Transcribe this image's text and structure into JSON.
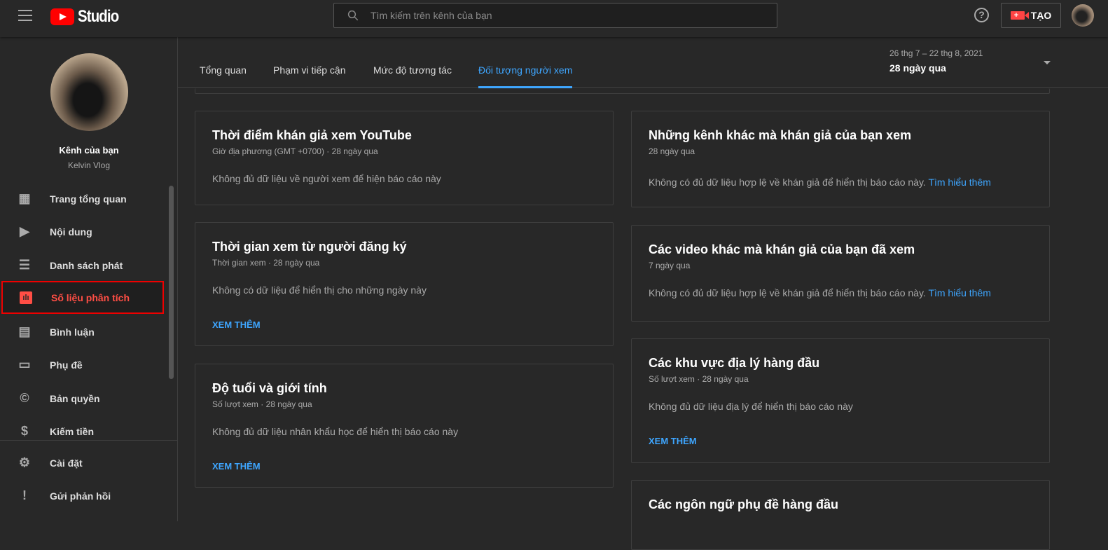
{
  "header": {
    "logo": "Studio",
    "search_placeholder": "Tìm kiếm trên kênh của bạn",
    "help": "?",
    "create": "TẠO"
  },
  "channel": {
    "title": "Kênh của bạn",
    "name": "Kelvin Vlog"
  },
  "sidebar": {
    "items": [
      {
        "label": "Trang tổng quan",
        "icon": "dashboard-icon"
      },
      {
        "label": "Nội dung",
        "icon": "content-icon"
      },
      {
        "label": "Danh sách phát",
        "icon": "playlist-icon"
      },
      {
        "label": "Số liệu phân tích",
        "icon": "analytics-icon",
        "active": true
      },
      {
        "label": "Bình luận",
        "icon": "comments-icon"
      },
      {
        "label": "Phụ đề",
        "icon": "subtitles-icon"
      },
      {
        "label": "Bản quyền",
        "icon": "copyright-icon"
      },
      {
        "label": "Kiếm tiền",
        "icon": "monetization-icon"
      },
      {
        "label": "Cài đặt",
        "icon": "settings-icon"
      },
      {
        "label": "Gửi phản hồi",
        "icon": "feedback-icon"
      }
    ]
  },
  "tabs": [
    "Tổng quan",
    "Phạm vi tiếp cận",
    "Mức độ tương tác",
    "Đối tượng người xem"
  ],
  "range": {
    "dates": "26 thg 7 – 22 thg 8, 2021",
    "period": "28 ngày qua"
  },
  "cards": {
    "c1": {
      "title": "Thời điểm khán giả xem YouTube",
      "sub": "Giờ địa phương (GMT +0700) · 28 ngày qua",
      "msg": "Không đủ dữ liệu về người xem để hiện báo cáo này"
    },
    "c2": {
      "title": "Thời gian xem từ người đăng ký",
      "sub": "Thời gian xem · 28 ngày qua",
      "msg": "Không có dữ liệu để hiển thị cho những ngày này",
      "more": "XEM THÊM"
    },
    "c3": {
      "title": "Độ tuổi và giới tính",
      "sub": "Số lượt xem · 28 ngày qua",
      "msg": "Không đủ dữ liệu nhân khẩu học để hiển thị báo cáo này",
      "more": "XEM THÊM"
    },
    "c4": {
      "title": "Những kênh khác mà khán giả của bạn xem",
      "sub": "28 ngày qua",
      "msg": "Không có đủ dữ liệu hợp lệ về khán giả để hiển thị báo cáo này.",
      "link": "Tìm hiểu thêm"
    },
    "c5": {
      "title": "Các video khác mà khán giả của bạn đã xem",
      "sub": "7 ngày qua",
      "msg": "Không có đủ dữ liệu hợp lệ về khán giả để hiển thị báo cáo này.",
      "link": "Tìm hiểu thêm"
    },
    "c6": {
      "title": "Các khu vực địa lý hàng đầu",
      "sub": "Số lượt xem · 28 ngày qua",
      "msg": "Không đủ dữ liệu địa lý để hiển thị báo cáo này",
      "more": "XEM THÊM"
    },
    "c7": {
      "title": "Các ngôn ngữ phụ đề hàng đầu"
    }
  }
}
